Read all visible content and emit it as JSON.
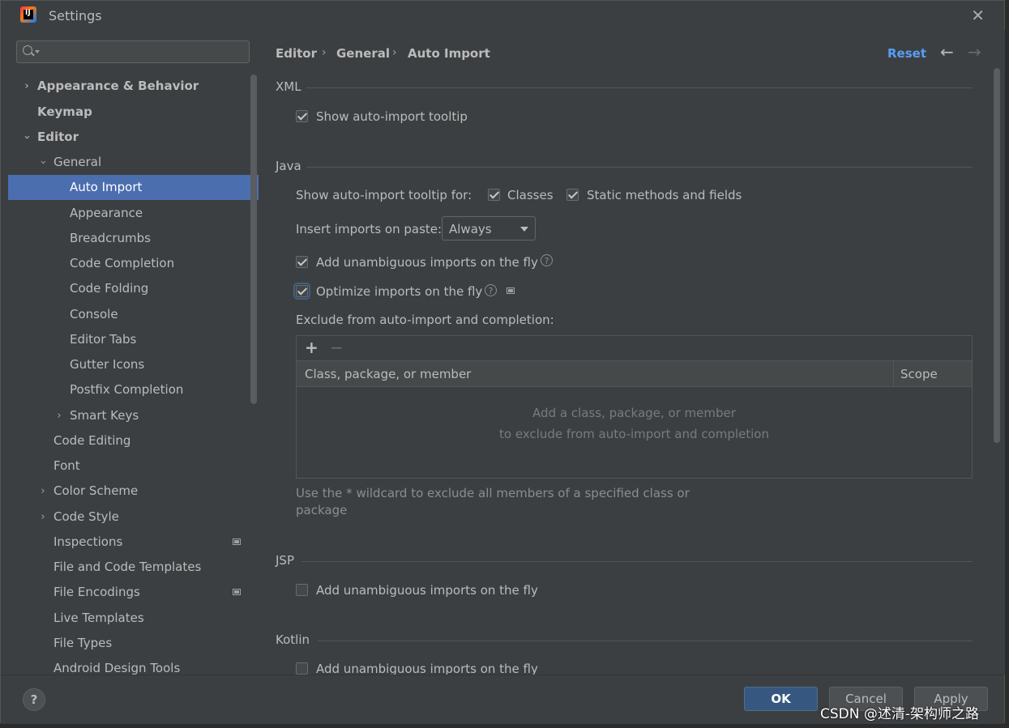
{
  "window": {
    "title": "Settings",
    "close": "✕",
    "app_icon_text": "IJ"
  },
  "sidebar": {
    "search_placeholder": "",
    "items": [
      {
        "label": "Appearance & Behavior"
      },
      {
        "label": "Keymap"
      },
      {
        "label": "Editor"
      },
      {
        "label": "General"
      },
      {
        "label": "Auto Import"
      },
      {
        "label": "Appearance"
      },
      {
        "label": "Breadcrumbs"
      },
      {
        "label": "Code Completion"
      },
      {
        "label": "Code Folding"
      },
      {
        "label": "Console"
      },
      {
        "label": "Editor Tabs"
      },
      {
        "label": "Gutter Icons"
      },
      {
        "label": "Postfix Completion"
      },
      {
        "label": "Smart Keys"
      },
      {
        "label": "Code Editing"
      },
      {
        "label": "Font"
      },
      {
        "label": "Color Scheme"
      },
      {
        "label": "Code Style"
      },
      {
        "label": "Inspections"
      },
      {
        "label": "File and Code Templates"
      },
      {
        "label": "File Encodings"
      },
      {
        "label": "Live Templates"
      },
      {
        "label": "File Types"
      },
      {
        "label": "Android Design Tools"
      }
    ]
  },
  "breadcrumb": {
    "items": [
      "Editor",
      "General",
      "Auto Import"
    ],
    "sep": "›"
  },
  "header": {
    "reset": "Reset",
    "back": "←",
    "forward": "→"
  },
  "xml": {
    "title": "XML",
    "show_tooltip": "Show auto-import tooltip"
  },
  "java": {
    "title": "Java",
    "tooltip_for": "Show auto-import tooltip for:",
    "classes": "Classes",
    "static": "Static methods and fields",
    "insert_label": "Insert imports on paste:",
    "insert_value": "Always",
    "unambiguous": "Add unambiguous imports on the fly",
    "optimize": "Optimize imports on the fly",
    "help": "?",
    "exclude_label": "Exclude from auto-import and completion:",
    "table": {
      "add": "+",
      "remove": "−",
      "col1": "Class, package, or member",
      "col2": "Scope",
      "empty1": "Add a class, package, or member",
      "empty2": "to exclude from auto-import and completion"
    },
    "hint1": "Use the * wildcard to exclude all members of a specified class or",
    "hint2": "package"
  },
  "jsp": {
    "title": "JSP",
    "unambiguous": "Add unambiguous imports on the fly"
  },
  "kotlin": {
    "title": "Kotlin",
    "unambiguous": "Add unambiguous imports on the fly"
  },
  "footer": {
    "help": "?",
    "ok": "OK",
    "cancel": "Cancel",
    "apply": "Apply"
  },
  "watermark": "CSDN @述清-架构师之路"
}
